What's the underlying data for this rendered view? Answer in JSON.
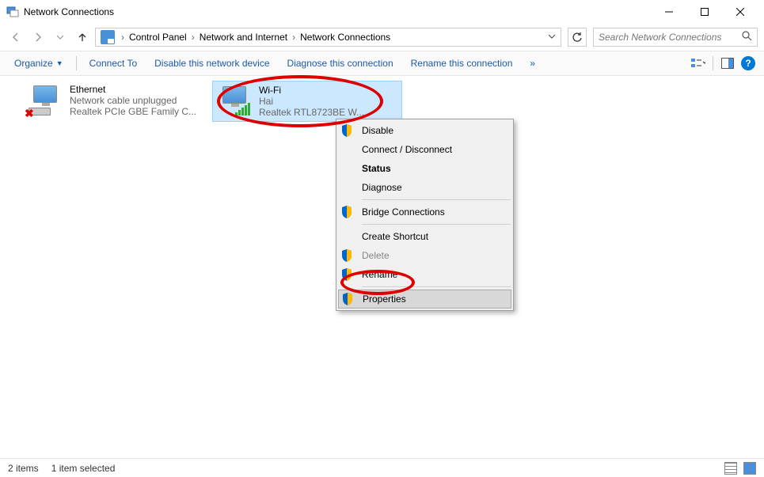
{
  "window": {
    "title": "Network Connections"
  },
  "breadcrumb": {
    "parts": [
      "Control Panel",
      "Network and Internet",
      "Network Connections"
    ]
  },
  "search": {
    "placeholder": "Search Network Connections"
  },
  "toolbar": {
    "organize": "Organize",
    "connect_to": "Connect To",
    "disable": "Disable this network device",
    "diagnose": "Diagnose this connection",
    "rename": "Rename this connection",
    "overflow": "»"
  },
  "adapters": [
    {
      "name": "Ethernet",
      "status": "Network cable unplugged",
      "device": "Realtek PCIe GBE Family C..."
    },
    {
      "name": "Wi-Fi",
      "status": "Hai",
      "device": "Realtek RTL8723BE W..."
    }
  ],
  "ctx": {
    "disable": "Disable",
    "connect": "Connect / Disconnect",
    "status": "Status",
    "diagnose": "Diagnose",
    "bridge": "Bridge Connections",
    "shortcut": "Create Shortcut",
    "delete": "Delete",
    "rename": "Rename",
    "properties": "Properties"
  },
  "status": {
    "count": "2 items",
    "selected": "1 item selected"
  }
}
